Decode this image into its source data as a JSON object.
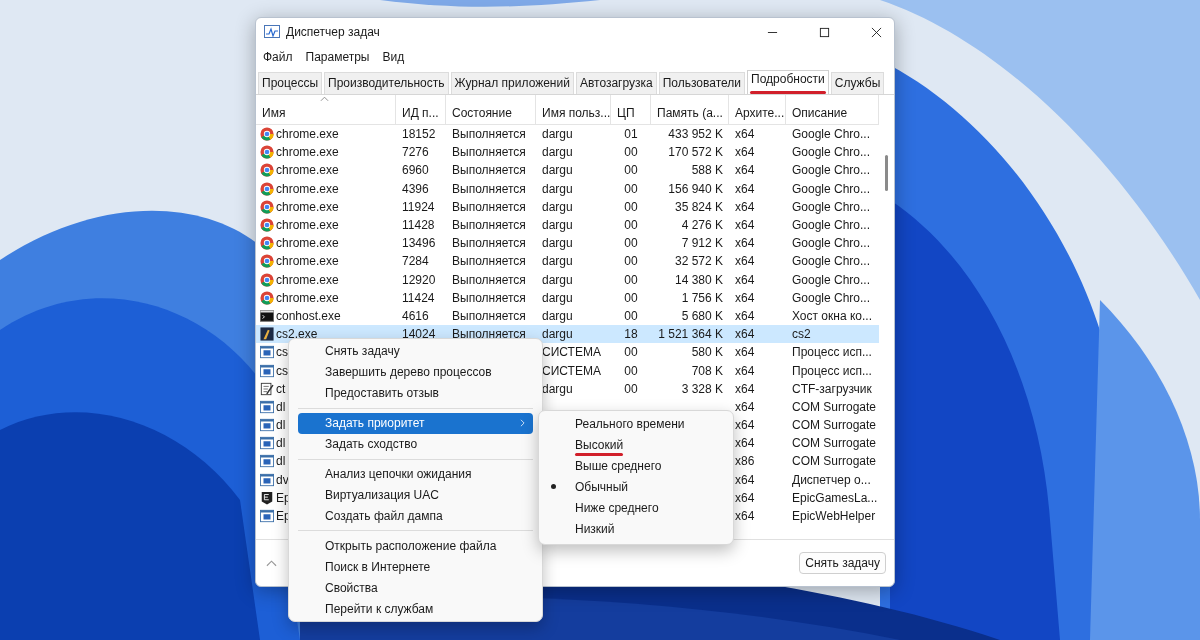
{
  "window": {
    "title": "Диспетчер задач"
  },
  "menu_bar": [
    "Файл",
    "Параметры",
    "Вид"
  ],
  "tabs": [
    {
      "label": "Процессы",
      "selected": false
    },
    {
      "label": "Производительность",
      "selected": false
    },
    {
      "label": "Журнал приложений",
      "selected": false
    },
    {
      "label": "Автозагрузка",
      "selected": false
    },
    {
      "label": "Пользователи",
      "selected": false
    },
    {
      "label": "Подробности",
      "selected": true,
      "marked": true
    },
    {
      "label": "Службы",
      "selected": false
    }
  ],
  "table": {
    "columns": [
      {
        "label": "Имя",
        "sorted": true
      },
      {
        "label": "ИД п..."
      },
      {
        "label": "Состояние"
      },
      {
        "label": "Имя польз..."
      },
      {
        "label": "ЦП"
      },
      {
        "label": "Память (а..."
      },
      {
        "label": "Архите..."
      },
      {
        "label": "Описание"
      }
    ],
    "rows": [
      {
        "kind": "chrome",
        "name": "chrome.exe",
        "pid": "18152",
        "status": "Выполняется",
        "user": "dargu",
        "cpu": "01",
        "memory": "433 952 K",
        "arch": "x64",
        "description": "Google Chro...",
        "selected": false
      },
      {
        "kind": "chrome",
        "name": "chrome.exe",
        "pid": "7276",
        "status": "Выполняется",
        "user": "dargu",
        "cpu": "00",
        "memory": "170 572 K",
        "arch": "x64",
        "description": "Google Chro...",
        "selected": false
      },
      {
        "kind": "chrome",
        "name": "chrome.exe",
        "pid": "6960",
        "status": "Выполняется",
        "user": "dargu",
        "cpu": "00",
        "memory": "588 K",
        "arch": "x64",
        "description": "Google Chro...",
        "selected": false
      },
      {
        "kind": "chrome",
        "name": "chrome.exe",
        "pid": "4396",
        "status": "Выполняется",
        "user": "dargu",
        "cpu": "00",
        "memory": "156 940 K",
        "arch": "x64",
        "description": "Google Chro...",
        "selected": false
      },
      {
        "kind": "chrome",
        "name": "chrome.exe",
        "pid": "11924",
        "status": "Выполняется",
        "user": "dargu",
        "cpu": "00",
        "memory": "35 824 K",
        "arch": "x64",
        "description": "Google Chro...",
        "selected": false
      },
      {
        "kind": "chrome",
        "name": "chrome.exe",
        "pid": "11428",
        "status": "Выполняется",
        "user": "dargu",
        "cpu": "00",
        "memory": "4 276 K",
        "arch": "x64",
        "description": "Google Chro...",
        "selected": false
      },
      {
        "kind": "chrome",
        "name": "chrome.exe",
        "pid": "13496",
        "status": "Выполняется",
        "user": "dargu",
        "cpu": "00",
        "memory": "7 912 K",
        "arch": "x64",
        "description": "Google Chro...",
        "selected": false
      },
      {
        "kind": "chrome",
        "name": "chrome.exe",
        "pid": "7284",
        "status": "Выполняется",
        "user": "dargu",
        "cpu": "00",
        "memory": "32 572 K",
        "arch": "x64",
        "description": "Google Chro...",
        "selected": false
      },
      {
        "kind": "chrome",
        "name": "chrome.exe",
        "pid": "12920",
        "status": "Выполняется",
        "user": "dargu",
        "cpu": "00",
        "memory": "14 380 K",
        "arch": "x64",
        "description": "Google Chro...",
        "selected": false
      },
      {
        "kind": "chrome",
        "name": "chrome.exe",
        "pid": "11424",
        "status": "Выполняется",
        "user": "dargu",
        "cpu": "00",
        "memory": "1 756 K",
        "arch": "x64",
        "description": "Google Chro...",
        "selected": false
      },
      {
        "kind": "console",
        "name": "conhost.exe",
        "pid": "4616",
        "status": "Выполняется",
        "user": "dargu",
        "cpu": "00",
        "memory": "5 680 K",
        "arch": "x64",
        "description": "Хост окна ко...",
        "selected": false
      },
      {
        "kind": "game",
        "name": "cs2.exe",
        "pid": "14024",
        "status": "Выполняется",
        "user": "dargu",
        "cpu": "18",
        "memory": "1 521 364 K",
        "arch": "x64",
        "description": "cs2",
        "selected": true
      },
      {
        "kind": "window",
        "name": "cs",
        "user": "СИСТЕМА",
        "cpu": "00",
        "memory": "580 K",
        "arch": "x64",
        "description": "Процесс исп...",
        "selected": false
      },
      {
        "kind": "window",
        "name": "cs",
        "user": "СИСТЕМА",
        "cpu": "00",
        "memory": "708 K",
        "arch": "x64",
        "description": "Процесс исп...",
        "selected": false
      },
      {
        "kind": "notepad",
        "name": "ct",
        "user": "dargu",
        "cpu": "00",
        "memory": "3 328 K",
        "arch": "x64",
        "description": "CTF-загрузчик",
        "selected": false
      },
      {
        "kind": "window",
        "name": "dl",
        "arch": "x64",
        "description": "COM Surrogate",
        "selected": false
      },
      {
        "kind": "window",
        "name": "dl",
        "arch": "x64",
        "description": "COM Surrogate",
        "selected": false
      },
      {
        "kind": "window",
        "name": "dl",
        "arch": "x64",
        "description": "COM Surrogate",
        "selected": false
      },
      {
        "kind": "window",
        "name": "dl",
        "arch": "x86",
        "description": "COM Surrogate",
        "selected": false
      },
      {
        "kind": "window",
        "name": "dv",
        "arch": "x64",
        "description": "Диспетчер о...",
        "selected": false
      },
      {
        "kind": "epic",
        "name": "Ep",
        "arch": "x64",
        "description": "EpicGamesLa...",
        "selected": false
      },
      {
        "kind": "window",
        "name": "Ep",
        "arch": "x64",
        "description": "EpicWebHelper",
        "selected": false
      }
    ]
  },
  "footer": {
    "button": "Снять задачу"
  },
  "context_menu": {
    "items": [
      {
        "kind": "item",
        "label": "Снять задачу",
        "selected": false
      },
      {
        "kind": "item",
        "label": "Завершить дерево процессов",
        "selected": false
      },
      {
        "kind": "item",
        "label": "Предоставить отзыв",
        "selected": false
      },
      {
        "kind": "separator"
      },
      {
        "kind": "item",
        "label": "Задать приоритет",
        "selected": true,
        "submenu": true
      },
      {
        "kind": "item",
        "label": "Задать сходство",
        "selected": false
      },
      {
        "kind": "separator"
      },
      {
        "kind": "item",
        "label": "Анализ цепочки ожидания",
        "selected": false
      },
      {
        "kind": "item",
        "label": "Виртуализация UAC",
        "selected": false
      },
      {
        "kind": "item",
        "label": "Создать файл дампа",
        "selected": false
      },
      {
        "kind": "separator"
      },
      {
        "kind": "item",
        "label": "Открыть расположение файла",
        "selected": false
      },
      {
        "kind": "item",
        "label": "Поиск в Интернете",
        "selected": false
      },
      {
        "kind": "item",
        "label": "Свойства",
        "selected": false
      },
      {
        "kind": "item",
        "label": "Перейти к службам",
        "selected": false
      }
    ]
  },
  "priority_menu": {
    "items": [
      {
        "label": "Реального времени",
        "checked": false
      },
      {
        "label": "Высокий",
        "checked": false,
        "marked": true
      },
      {
        "label": "Выше среднего",
        "checked": false
      },
      {
        "label": "Обычный",
        "checked": true
      },
      {
        "label": "Ниже среднего",
        "checked": false
      },
      {
        "label": "Низкий",
        "checked": false
      }
    ]
  }
}
